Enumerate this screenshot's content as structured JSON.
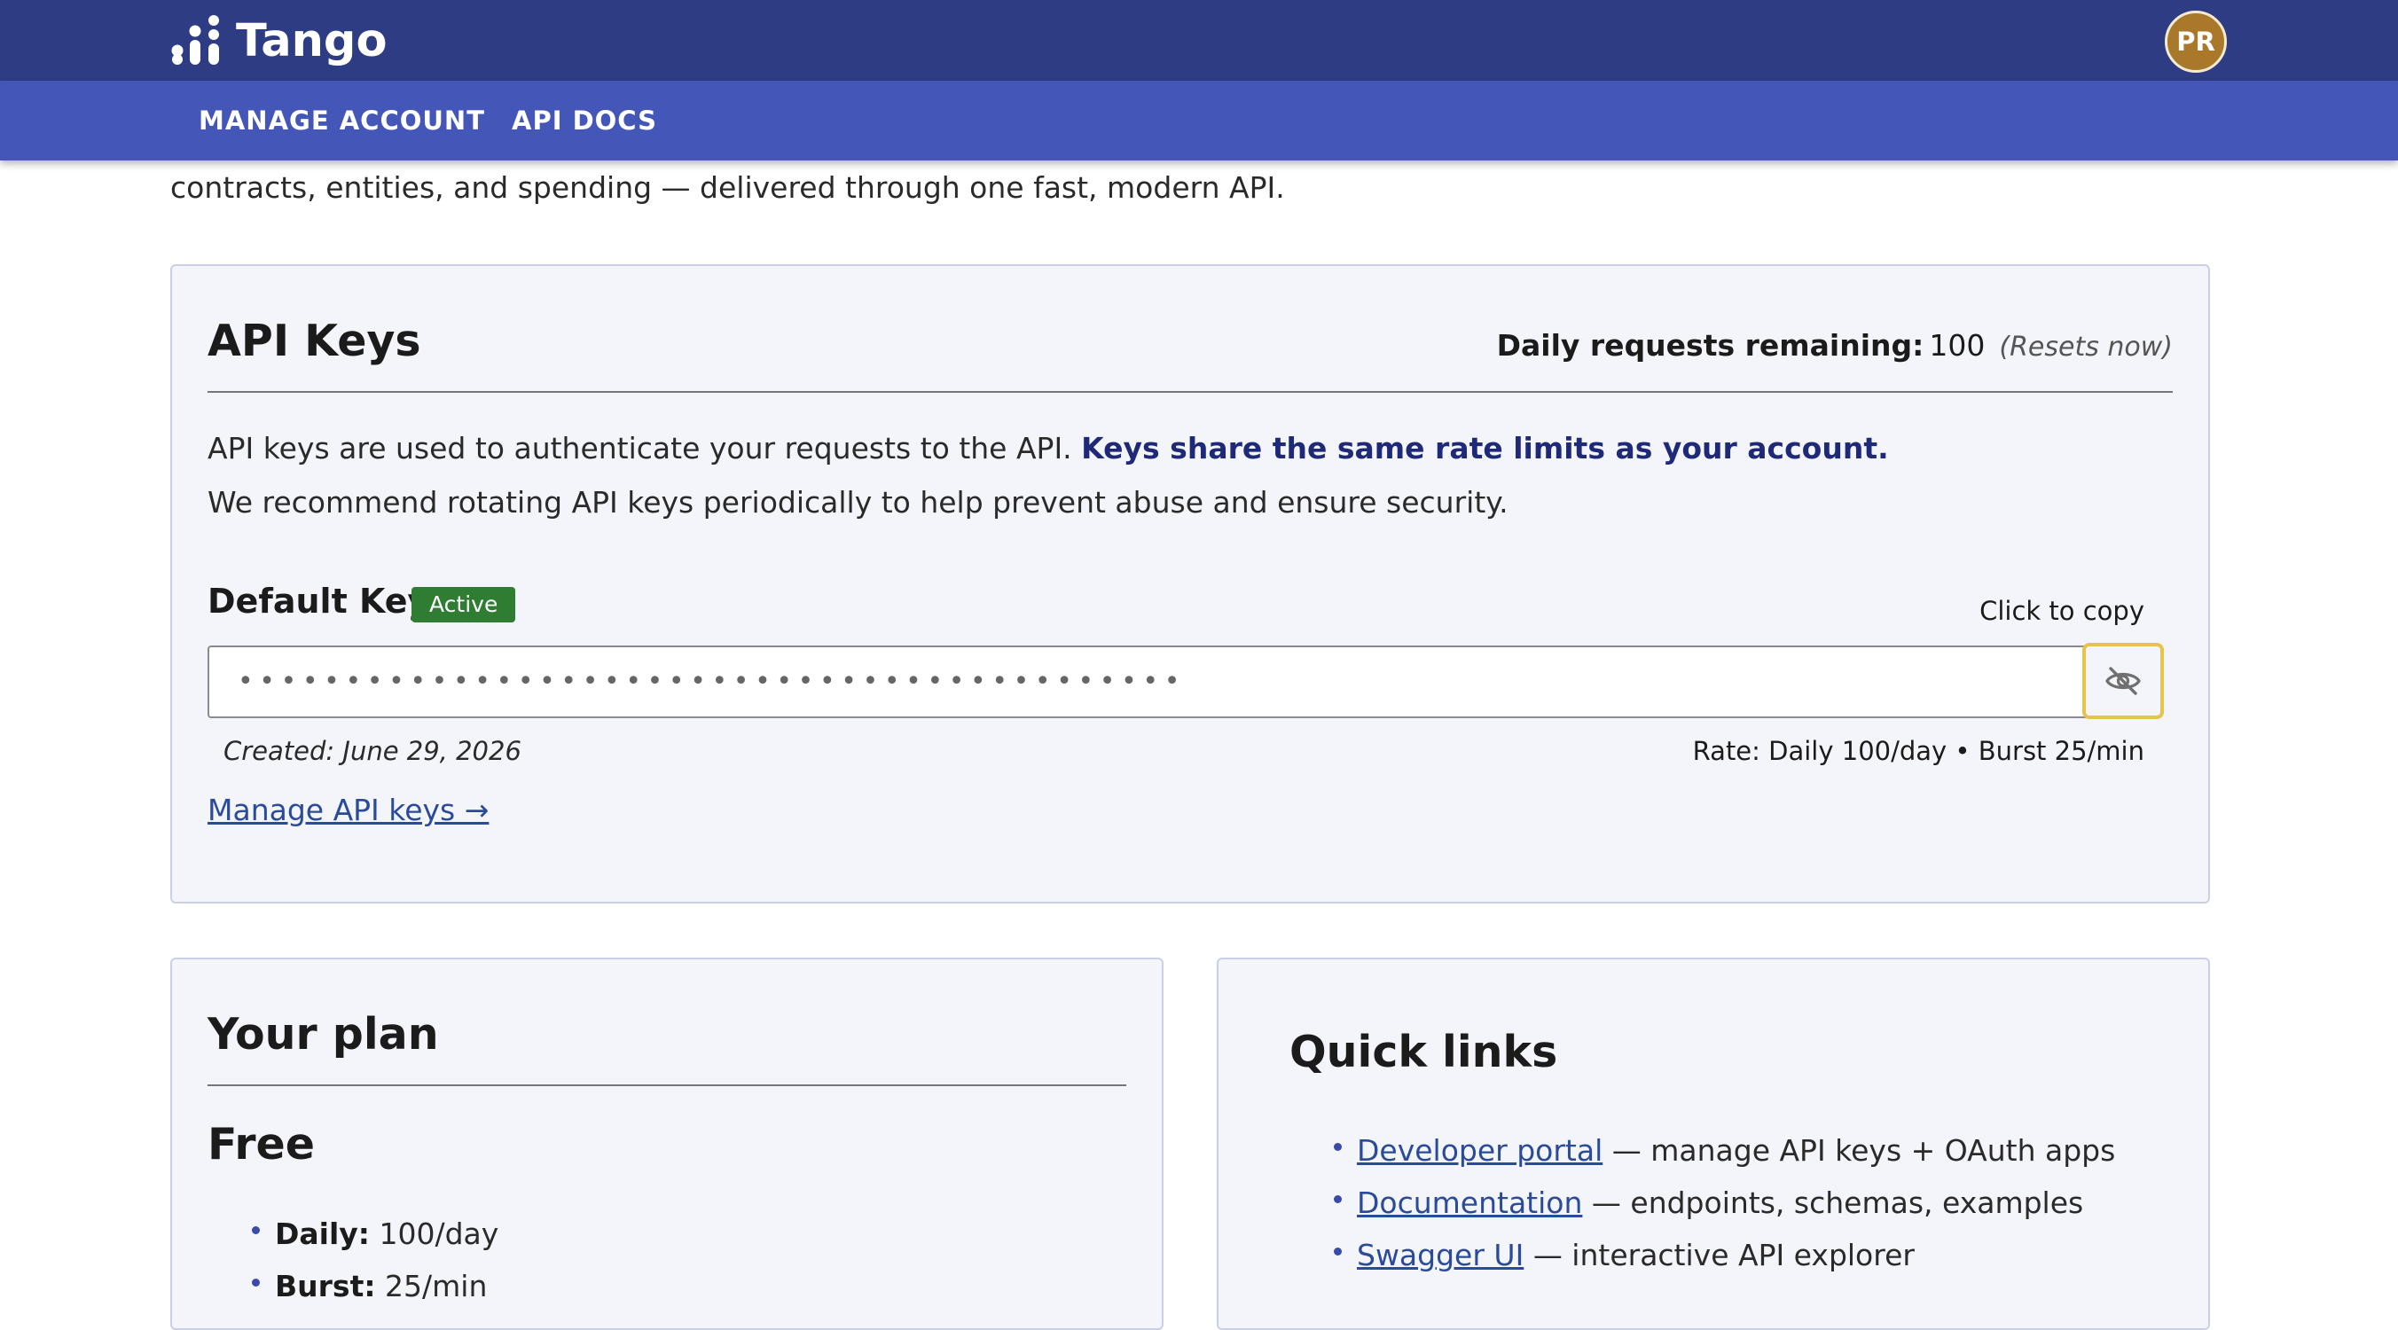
{
  "header": {
    "brand": "Tango",
    "avatar_initials": "PR",
    "colors": {
      "topbar": "#2e3c84",
      "navbar": "#4456b7",
      "avatar": "#a9782b"
    }
  },
  "nav": {
    "items": [
      {
        "label": "MANAGE ACCOUNT"
      },
      {
        "label": "API DOCS"
      }
    ]
  },
  "intro_text": "contracts, entities, and spending — delivered through one fast, modern API.",
  "api_keys": {
    "title": "API Keys",
    "daily_requests_label": "Daily requests remaining:",
    "daily_requests_value": "100",
    "resets_note": "(Resets now)",
    "description_line1": "API keys are used to authenticate your requests to the API.",
    "description_line1_emphasis": "Keys share the same rate limits as your account.",
    "description_line2": "We recommend rotating API keys periodically to help prevent abuse and ensure security.",
    "default_key": {
      "title": "Default Key",
      "status_badge": "Active",
      "copy_hint": "Click to copy",
      "masked_value": "••••••••••••••••••••••••••••••••••••••••••••",
      "toggle_icon": "eye-off-icon",
      "created": "Created: June 29, 2026",
      "rate": "Rate: Daily 100/day • Burst 25/min"
    },
    "manage_link": "Manage API keys →"
  },
  "plan": {
    "title": "Your plan",
    "name": "Free",
    "items": [
      {
        "key": "Daily:",
        "value": "100/day"
      },
      {
        "key": "Burst:",
        "value": "25/min"
      }
    ]
  },
  "quick_links": {
    "title": "Quick links",
    "items": [
      {
        "link": "Developer portal",
        "desc": "— manage API keys + OAuth apps"
      },
      {
        "link": "Documentation",
        "desc": "— endpoints, schemas, examples"
      },
      {
        "link": "Swagger UI",
        "desc": "— interactive API explorer"
      }
    ]
  }
}
